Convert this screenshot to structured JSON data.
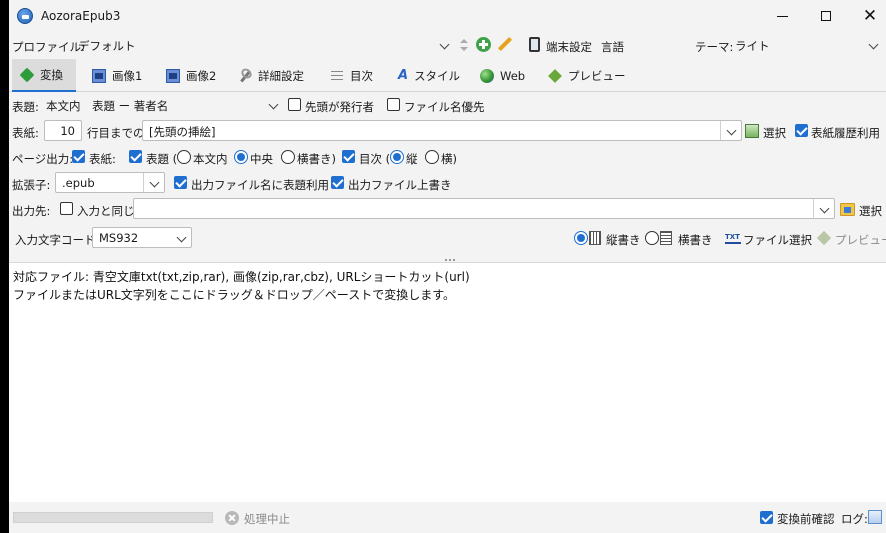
{
  "window": {
    "title": "AozoraEpub3"
  },
  "profile_row": {
    "profile_label": "プロファイル:",
    "profile_value": "デフォルト",
    "device_settings_label": "端末設定",
    "language_label": "言語",
    "theme_label": "テーマ:",
    "theme_value": "ライト"
  },
  "tabs": [
    {
      "label": "変換",
      "icon": "convert-icon",
      "active": true
    },
    {
      "label": "画像1",
      "icon": "image-icon",
      "active": false
    },
    {
      "label": "画像2",
      "icon": "image-icon",
      "active": false
    },
    {
      "label": "詳細設定",
      "icon": "wrench-icon",
      "active": false
    },
    {
      "label": "目次",
      "icon": "list-icon",
      "active": false
    },
    {
      "label": "スタイル",
      "icon": "style-icon",
      "active": false
    },
    {
      "label": "Web",
      "icon": "globe-icon",
      "active": false
    },
    {
      "label": "プレビュー",
      "icon": "preview-icon",
      "active": false
    }
  ],
  "title_row": {
    "label": "表題:",
    "value": "本文内　表題 ー 著者名",
    "author_first_label": "先頭が発行者",
    "author_first_checked": false,
    "filename_priority_label": "ファイル名優先",
    "filename_priority_checked": false
  },
  "cover_row": {
    "label": "表紙:",
    "line_count": "10",
    "lines_suffix": "行目までの",
    "cover_value": "[先頭の挿絵]",
    "select_label": "選択",
    "history_label": "表紙履歴利用",
    "history_checked": true
  },
  "page_output_row": {
    "label": "ページ出力:",
    "cover_label": "表紙:",
    "cover_checked": true,
    "title_label": "表題 (",
    "title_checked": true,
    "title_options": [
      {
        "label": "本文内",
        "selected": false
      },
      {
        "label": "中央",
        "selected": true
      },
      {
        "label": "横書き)",
        "selected": false
      }
    ],
    "toc_label": "目次 (",
    "toc_checked": true,
    "toc_options": [
      {
        "label": "縦",
        "selected": true
      },
      {
        "label": "横)",
        "selected": false
      }
    ]
  },
  "extension_row": {
    "label": "拡張子:",
    "value": ".epub",
    "use_title_filename_label": "出力ファイル名に表題利用",
    "use_title_filename_checked": true,
    "overwrite_label": "出力ファイル上書き",
    "overwrite_checked": true
  },
  "output_row": {
    "label": "出力先:",
    "same_as_input_label": "入力と同じ",
    "same_as_input_checked": false,
    "path_value": "",
    "select_label": "選択"
  },
  "encoding_row": {
    "label": "入力文字コード",
    "value": "MS932",
    "vertical_label": "縦書き",
    "vertical_selected": true,
    "horizontal_label": "横書き",
    "horizontal_selected": false,
    "file_select_label": "ファイル選択",
    "preview_label": "プレビュー"
  },
  "log": {
    "lines": [
      "対応ファイル: 青空文庫txt(txt,zip,rar), 画像(zip,rar,cbz), URLショートカット(url)",
      "ファイルまたはURL文字列をここにドラッグ＆ドロップ／ペーストで変換します。"
    ]
  },
  "status": {
    "progress": 0,
    "stop_label": "処理中止",
    "confirm_label": "変換前確認",
    "confirm_checked": true,
    "log_label": "ログ:"
  },
  "colors": {
    "accent": "#1f6fd1",
    "window_bg": "#f3f3f3",
    "left_strip": "#000000"
  }
}
